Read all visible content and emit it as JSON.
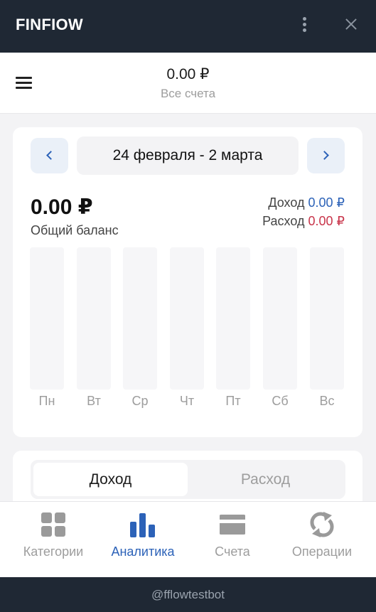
{
  "app": {
    "title": "FINFIOW"
  },
  "header": {
    "total_balance": "0.00 ₽",
    "accounts_label": "Все счета"
  },
  "week": {
    "range": "24 февраля - 2 марта"
  },
  "summary": {
    "balance": "0.00 ₽",
    "balance_label": "Общий баланс",
    "income_label": "Доход",
    "income_value": "0.00 ₽",
    "expense_label": "Расход",
    "expense_value": "0.00 ₽"
  },
  "chart_data": {
    "type": "bar",
    "categories": [
      "Пн",
      "Вт",
      "Ср",
      "Чт",
      "Пт",
      "Сб",
      "Вс"
    ],
    "values": [
      0,
      0,
      0,
      0,
      0,
      0,
      0
    ]
  },
  "toggle": {
    "income": "Доход",
    "expense": "Расход",
    "selected": "income"
  },
  "tabs": [
    {
      "label": "Категории",
      "icon": "grid-icon"
    },
    {
      "label": "Аналитика",
      "icon": "bar-chart-icon"
    },
    {
      "label": "Счета",
      "icon": "card-icon"
    },
    {
      "label": "Операции",
      "icon": "refresh-icon"
    }
  ],
  "active_tab": "Аналитика",
  "footer": {
    "bot_handle": "@fflowtestbot"
  },
  "colors": {
    "accent": "#2c62b8",
    "expense": "#c8344a",
    "dark_bar": "#1f2834"
  }
}
